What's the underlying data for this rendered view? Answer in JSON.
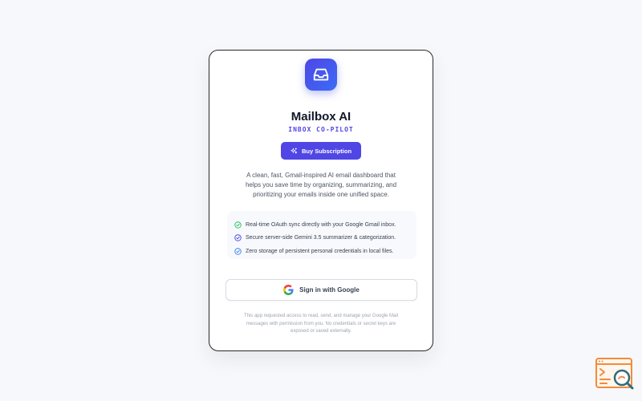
{
  "app": {
    "title": "Mailbox AI",
    "subtitle": "INBOX CO-PILOT",
    "logo_icon": "inbox-tray-icon"
  },
  "buy_button": {
    "label": "Buy Subscription",
    "icon": "sparkles-icon"
  },
  "description": "A clean, fast, Gmail-inspired AI email dashboard that helps you save time by organizing, summarizing, and prioritizing your emails inside one unified space.",
  "features": [
    {
      "text": "Real-time OAuth sync directly with your Google Gmail inbox.",
      "icon": "check-circle-icon",
      "color": "#22c55e"
    },
    {
      "text": "Secure server-side Gemini 3.5 summarizer & categorization.",
      "icon": "check-circle-icon",
      "color": "#4f46e5"
    },
    {
      "text": "Zero storage of persistent personal credentials in local files.",
      "icon": "check-circle-icon",
      "color": "#3b82f6"
    }
  ],
  "google_button": {
    "label": "Sign in with Google",
    "icon": "google-logo-icon"
  },
  "disclaimer": "This app requested access to read, send, and manage your Google Mail messages with permission from you. No credentials or secret keys are exposed or saved externally.",
  "colors": {
    "accent": "#4f46e5",
    "background": "#f7f8fb",
    "card": "#ffffff"
  }
}
